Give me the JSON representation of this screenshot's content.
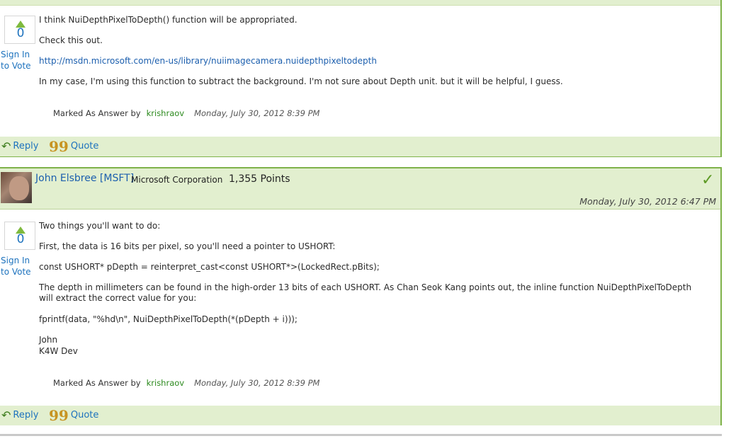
{
  "post1": {
    "votes": "0",
    "sign_in_vote": "Sign In to Vote",
    "lines": {
      "l1": "I think NuiDepthPixelToDepth() function will be appropriated.",
      "l2": "Check this out.",
      "link": "http://msdn.microsoft.com/en-us/library/nuiimagecamera.nuidepthpixeltodepth",
      "l4": "In my case, I'm using this function to subtract the background. I'm not sure about Depth unit. but it will be helpful, I guess."
    },
    "marked_label": "Marked As Answer by",
    "marked_user": "krishraov",
    "marked_date": "Monday, July 30, 2012 8:39 PM",
    "reply": "Reply",
    "quote": "Quote"
  },
  "post2": {
    "author": "John Elsbree [MSFT]",
    "org": "Microsoft Corporation",
    "points": "1,355 Points",
    "date": "Monday, July 30, 2012 6:47 PM",
    "votes": "0",
    "sign_in_vote": "Sign In to Vote",
    "lines": {
      "l1": "Two things you'll want to do:",
      "l2": "First, the data is 16 bits per pixel, so you'll need a pointer to USHORT:",
      "l3": "const USHORT* pDepth = reinterpret_cast<const USHORT*>(LockedRect.pBits);",
      "l4": "The depth in millimeters can be found in the high-order 13 bits of each USHORT. As Chan Seok Kang points out, the inline function NuiDepthPixelToDepth will extract the correct value for you:",
      "l5": "fprintf(data, \"%hd\\n\", NuiDepthPixelToDepth(*(pDepth + i)));",
      "l6": "John",
      "l7": "K4W Dev"
    },
    "marked_label": "Marked As Answer by",
    "marked_user": "krishraov",
    "marked_date": "Monday, July 30, 2012 8:39 PM",
    "reply": "Reply",
    "quote": "Quote"
  },
  "colors": {
    "accent_green": "#7fb24a",
    "bar_background": "#e2efcf",
    "link_blue": "#1c5fae"
  }
}
